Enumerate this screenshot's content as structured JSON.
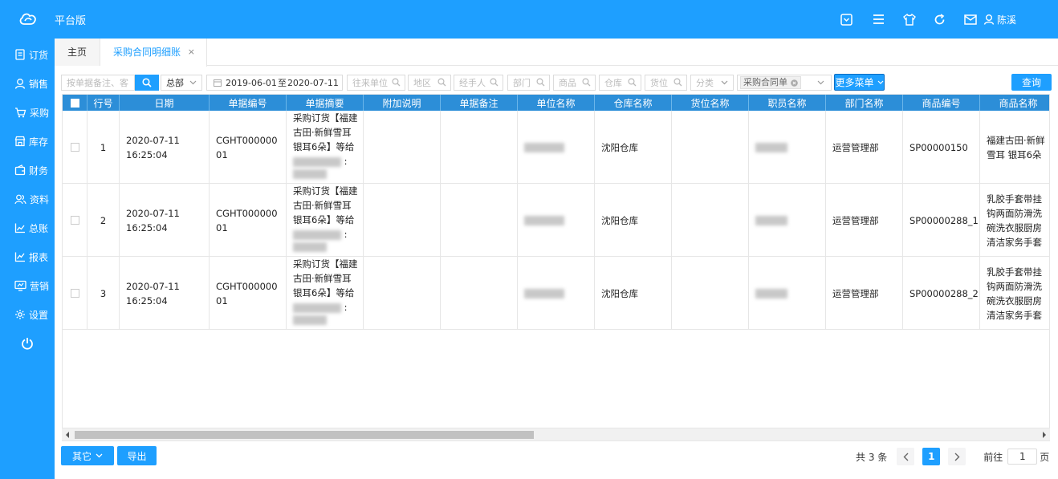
{
  "app": {
    "brand": "平台版",
    "user": "陈溪"
  },
  "sidebar": {
    "items": [
      {
        "label": "订货",
        "icon": "order-icon"
      },
      {
        "label": "销售",
        "icon": "user-icon"
      },
      {
        "label": "采购",
        "icon": "cart-icon"
      },
      {
        "label": "库存",
        "icon": "store-icon"
      },
      {
        "label": "财务",
        "icon": "wallet-icon"
      },
      {
        "label": "资料",
        "icon": "people-icon"
      },
      {
        "label": "总账",
        "icon": "chart-icon"
      },
      {
        "label": "报表",
        "icon": "report-icon"
      },
      {
        "label": "营销",
        "icon": "marketing-icon"
      },
      {
        "label": "设置",
        "icon": "gear-icon"
      }
    ]
  },
  "tabs": {
    "home": "主页",
    "active": "采购合同明细账",
    "close": "×"
  },
  "filters": {
    "search_placeholder": "按单据备注、客",
    "scope": "总部",
    "date_from": "2019-06-01",
    "date_sep": "至",
    "date_to": "2020-07-11",
    "partner": "往来单位",
    "region": "地区",
    "handler": "经手人",
    "dept": "部门",
    "goods": "商品",
    "warehouse": "仓库",
    "location": "货位",
    "category": "分类",
    "doc_type": "采购合同单",
    "more": "更多菜单",
    "query": "查询"
  },
  "table": {
    "headers": [
      "行号",
      "日期",
      "单据编号",
      "单据摘要",
      "附加说明",
      "单据备注",
      "单位名称",
      "仓库名称",
      "货位名称",
      "职员名称",
      "部门名称",
      "商品编号",
      "商品名称"
    ],
    "rows": [
      {
        "no": "1",
        "date": "2020-07-11 16:25:04",
        "code": "CGHT00000001",
        "summary": "采购订货【福建古田·新鲜雪耳银耳6朵】等给",
        "summary_tail": ":",
        "warehouse": "沈阳仓库",
        "dept": "运营管理部",
        "goods_code": "SP00000150",
        "goods_name": "福建古田·新鲜雪耳 银耳6朵"
      },
      {
        "no": "2",
        "date": "2020-07-11 16:25:04",
        "code": "CGHT00000001",
        "summary": "采购订货【福建古田·新鲜雪耳银耳6朵】等给",
        "summary_tail": ":",
        "warehouse": "沈阳仓库",
        "dept": "运营管理部",
        "goods_code": "SP00000288_1",
        "goods_name": "乳胶手套带挂钩两面防滑洗碗洗衣服厨房清洁家务手套"
      },
      {
        "no": "3",
        "date": "2020-07-11 16:25:04",
        "code": "CGHT00000001",
        "summary": "采购订货【福建古田·新鲜雪耳银耳6朵】等给",
        "summary_tail": ":",
        "warehouse": "沈阳仓库",
        "dept": "运营管理部",
        "goods_code": "SP00000288_2",
        "goods_name": "乳胶手套带挂钩两面防滑洗碗洗衣服厨房清洁家务手套"
      }
    ]
  },
  "footer": {
    "other": "其它",
    "export": "导出",
    "total": "共 3 条",
    "page": "1",
    "goto": "前往",
    "goto_value": "1",
    "page_unit": "页"
  },
  "colors": {
    "primary": "#1e9fff",
    "header": "#2c8ed8"
  }
}
